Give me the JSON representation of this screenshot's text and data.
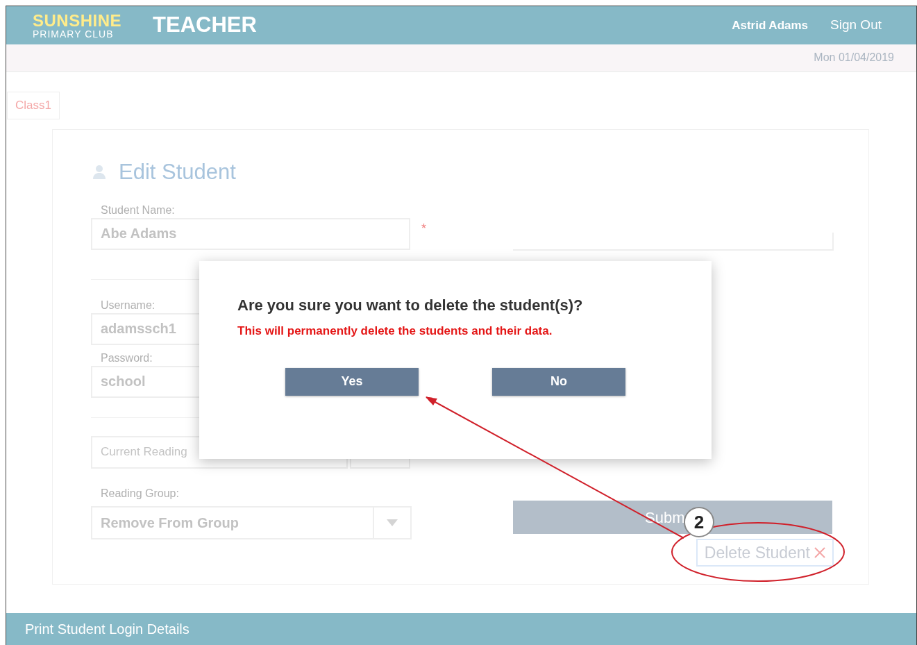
{
  "header": {
    "logo": {
      "line_1": "SUNSHINE",
      "line_2": "PRIMARY CLUB"
    },
    "role": "TEACHER",
    "user": "Astrid Adams",
    "sign_out": "Sign Out"
  },
  "date": "Mon 01/04/2019",
  "class_tab": "Class1",
  "form": {
    "title": "Edit Student",
    "fields": [
      {
        "label": "Student Name:",
        "value": "Abe Adams",
        "required_mark": "*"
      },
      {
        "label": "Username:",
        "value": "adamssch1"
      },
      {
        "label": "Password:",
        "value": "school"
      }
    ],
    "reading_level": "Current Reading",
    "reading_group": {
      "label": "Reading Group:",
      "value": "Remove From Group"
    },
    "submit": "Subm",
    "delete": "Delete Student"
  },
  "dialog": {
    "title": "Are you sure you want to delete the student(s)?",
    "warning": "This will permanently delete the students and their data.",
    "buttons": [
      "Yes",
      "No"
    ]
  },
  "footer": "Print Student Login Details",
  "annotation": {
    "number": "2"
  }
}
